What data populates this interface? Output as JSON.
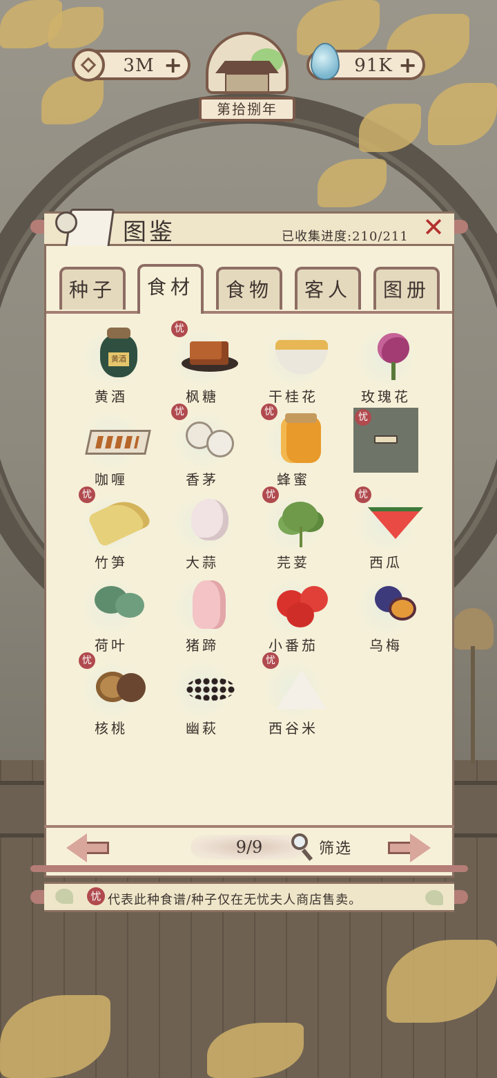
{
  "hud": {
    "coins": "3M",
    "spirit": "91K",
    "year_label": "第拾捌年"
  },
  "panel": {
    "title": "图鉴",
    "progress": "已收集进度:210/211",
    "tabs": [
      {
        "label": "种子",
        "active": false
      },
      {
        "label": "食材",
        "active": true
      },
      {
        "label": "食物",
        "active": false
      },
      {
        "label": "客人",
        "active": false
      },
      {
        "label": "图册",
        "active": false
      }
    ]
  },
  "items": [
    {
      "name": "黄酒",
      "badge": false,
      "icon": "yellow-wine-jar-icon"
    },
    {
      "name": "枫糖",
      "badge": true,
      "icon": "maple-sugar-icon"
    },
    {
      "name": "干桂花",
      "badge": false,
      "icon": "dried-osmanthus-icon"
    },
    {
      "name": "玫瑰花",
      "badge": false,
      "icon": "rose-icon"
    },
    {
      "name": "咖喱",
      "badge": false,
      "icon": "curry-icon"
    },
    {
      "name": "香茅",
      "badge": true,
      "icon": "lemongrass-icon"
    },
    {
      "name": "蜂蜜",
      "badge": true,
      "icon": "honey-jar-icon"
    },
    {
      "name": "",
      "badge": true,
      "icon": "locked-slot-icon"
    },
    {
      "name": "竹笋",
      "badge": true,
      "icon": "bamboo-shoot-icon"
    },
    {
      "name": "大蒜",
      "badge": false,
      "icon": "garlic-icon"
    },
    {
      "name": "芫荽",
      "badge": true,
      "icon": "cilantro-icon"
    },
    {
      "name": "西瓜",
      "badge": true,
      "icon": "watermelon-icon"
    },
    {
      "name": "荷叶",
      "badge": false,
      "icon": "lotus-leaf-icon"
    },
    {
      "name": "猪蹄",
      "badge": false,
      "icon": "pig-trotter-icon"
    },
    {
      "name": "小番茄",
      "badge": false,
      "icon": "cherry-tomato-icon"
    },
    {
      "name": "乌梅",
      "badge": false,
      "icon": "dark-plum-icon"
    },
    {
      "name": "核桃",
      "badge": true,
      "icon": "walnut-icon"
    },
    {
      "name": "幽萩",
      "badge": false,
      "icon": "raisins-icon"
    },
    {
      "name": "西谷米",
      "badge": true,
      "icon": "sago-icon"
    }
  ],
  "badge_char": "忧",
  "pagination": {
    "page": "9/9",
    "filter_label": "筛选"
  },
  "notice": {
    "text": "代表此种食谱/种子仅在无忧夫人商店售卖。"
  }
}
